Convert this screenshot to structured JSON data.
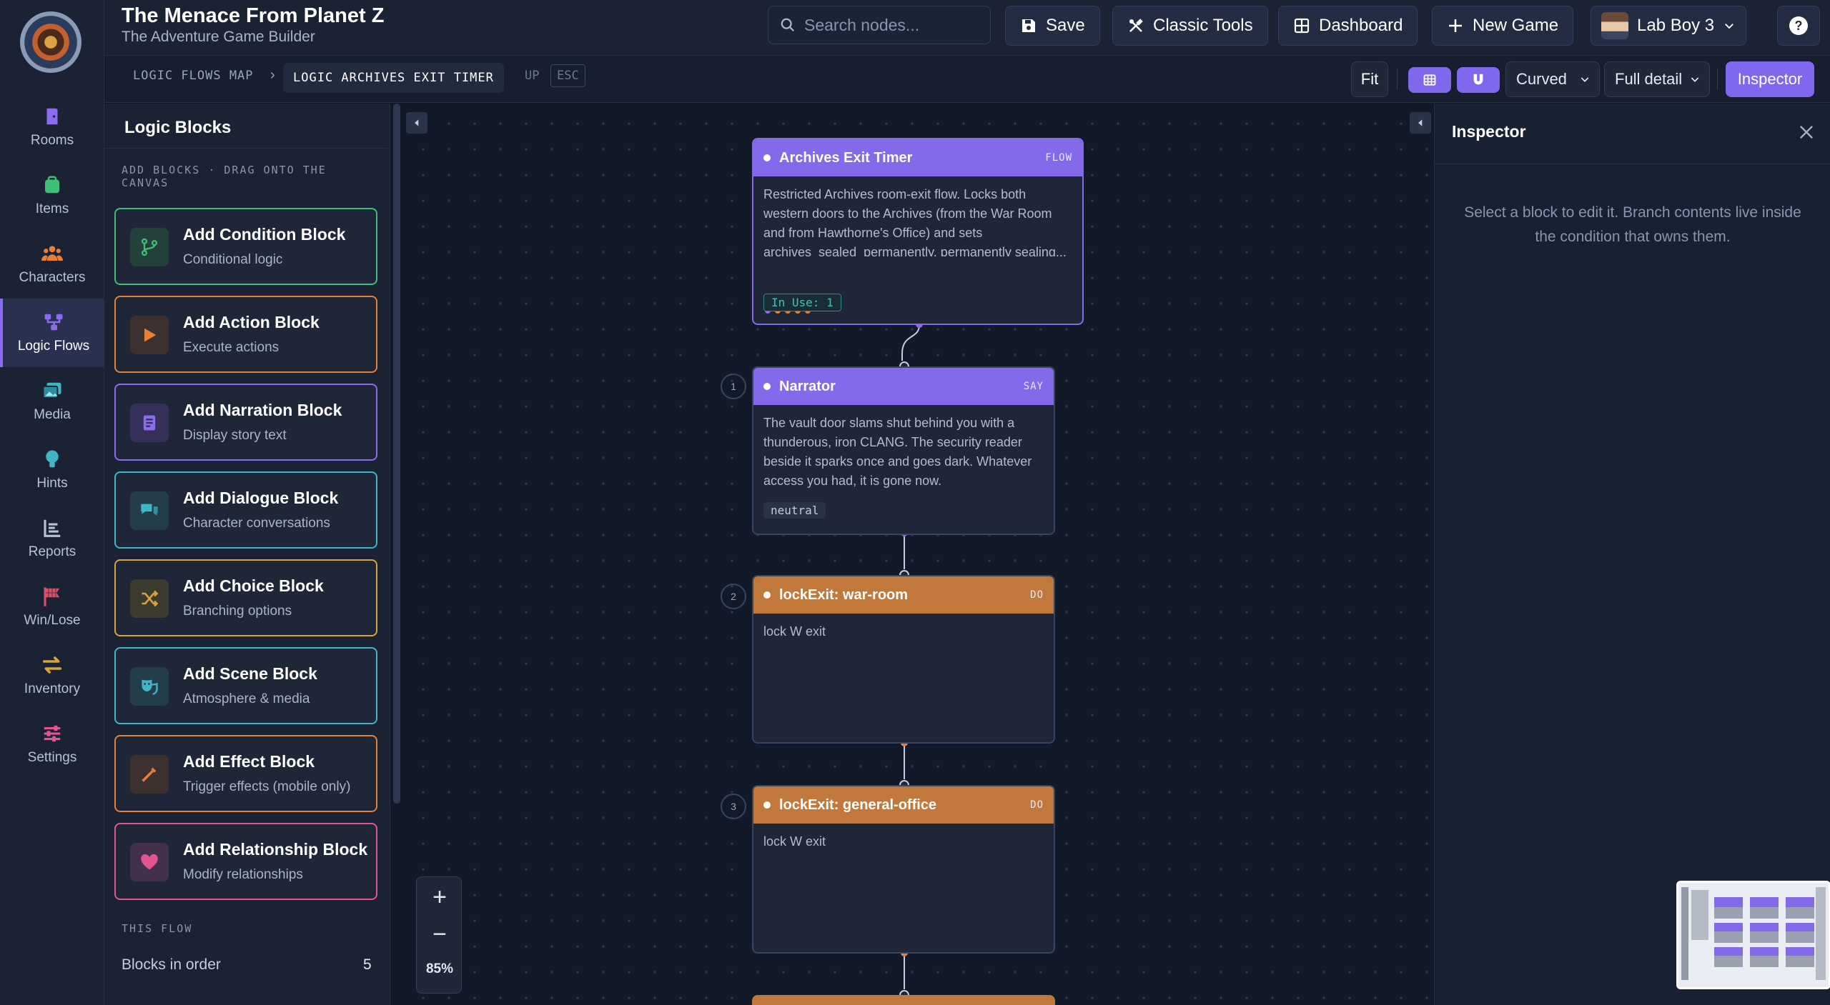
{
  "app": {
    "title": "The Menace From Planet Z",
    "subtitle": "The Adventure Game Builder"
  },
  "nav": {
    "items": [
      {
        "label": "Rooms",
        "icon": "door-icon",
        "color": "#8b6cf0"
      },
      {
        "label": "Items",
        "icon": "bag-icon",
        "color": "#3fbf74"
      },
      {
        "label": "Characters",
        "icon": "people-icon",
        "color": "#e8803a"
      },
      {
        "label": "Logic Flows",
        "icon": "flow-icon",
        "color": "#8b6cf0",
        "active": true
      },
      {
        "label": "Media",
        "icon": "images-icon",
        "color": "#3fb6c8"
      },
      {
        "label": "Hints",
        "icon": "lightbulb-icon",
        "color": "#3fb6c8"
      },
      {
        "label": "Reports",
        "icon": "list-icon",
        "color": "#b8c1d6"
      },
      {
        "label": "Win/Lose",
        "icon": "flag-icon",
        "color": "#e04f6a"
      },
      {
        "label": "Inventory",
        "icon": "swap-icon",
        "color": "#d8a53a"
      },
      {
        "label": "Settings",
        "icon": "sliders-icon",
        "color": "#e2558f"
      }
    ]
  },
  "header": {
    "search_placeholder": "Search nodes...",
    "save": "Save",
    "classic_tools": "Classic Tools",
    "dashboard": "Dashboard",
    "new_game": "New Game",
    "user": "Lab Boy 3",
    "help": "?"
  },
  "toolbar": {
    "crumb_root": "LOGIC FLOWS MAP",
    "crumb_sep": "›",
    "crumb_current": "LOGIC ARCHIVES EXIT TIMER",
    "up": "UP",
    "esc": "ESC",
    "fit": "Fit",
    "edge_style": "Curved",
    "detail": "Full detail",
    "inspector": "Inspector"
  },
  "blocks_panel": {
    "title": "Logic Blocks",
    "hint": "ADD BLOCKS · DRAG ONTO THE CANVAS",
    "blocks": [
      {
        "title": "Add Condition Block",
        "subtitle": "Conditional logic",
        "icon": "branch-icon",
        "color": "#3fbf74"
      },
      {
        "title": "Add Action Block",
        "subtitle": "Execute actions",
        "icon": "play-icon",
        "color": "#e8803a"
      },
      {
        "title": "Add Narration Block",
        "subtitle": "Display story text",
        "icon": "book-icon",
        "color": "#8b6cf0"
      },
      {
        "title": "Add Dialogue Block",
        "subtitle": "Character conversations",
        "icon": "chat-icon",
        "color": "#3fb6c8"
      },
      {
        "title": "Add Choice Block",
        "subtitle": "Branching options",
        "icon": "shuffle-icon",
        "color": "#d8a53a"
      },
      {
        "title": "Add Scene Block",
        "subtitle": "Atmosphere & media",
        "icon": "masks-icon",
        "color": "#3fb6c8"
      },
      {
        "title": "Add Effect Block",
        "subtitle": "Trigger effects (mobile only)",
        "icon": "wand-icon",
        "color": "#e8803a"
      },
      {
        "title": "Add Relationship Block",
        "subtitle": "Modify relationships",
        "icon": "heart-icon",
        "color": "#e2558f"
      }
    ],
    "this_flow": "THIS FLOW",
    "blocks_in_order_label": "Blocks in order",
    "blocks_in_order_count": "5"
  },
  "canvas": {
    "zoom": "85%",
    "zoom_in": "+",
    "zoom_out": "−",
    "nodes": [
      {
        "title": "Archives Exit Timer",
        "tag": "FLOW",
        "kind": "flow",
        "text": "Restricted Archives room-exit flow. Locks both western doors to the Archives (from the War Room and from Hawthorne's Office) and sets archives_sealed_permanently, permanently sealing...",
        "chip": "In Use: 1"
      },
      {
        "step": "1",
        "title": "Narrator",
        "tag": "SAY",
        "kind": "say",
        "text": "The vault door slams shut behind you with a thunderous, iron CLANG. The security reader beside it sparks once and goes dark. Whatever access you had, it is gone now.",
        "chip": "neutral"
      },
      {
        "step": "2",
        "title": "lockExit: war-room",
        "tag": "DO",
        "kind": "do",
        "text": "lock W exit"
      },
      {
        "step": "3",
        "title": "lockExit: general-office",
        "tag": "DO",
        "kind": "do",
        "text": "lock W exit"
      }
    ]
  },
  "inspector": {
    "title": "Inspector",
    "message": "Select a block to edit it. Branch contents live inside the condition that owns them."
  }
}
